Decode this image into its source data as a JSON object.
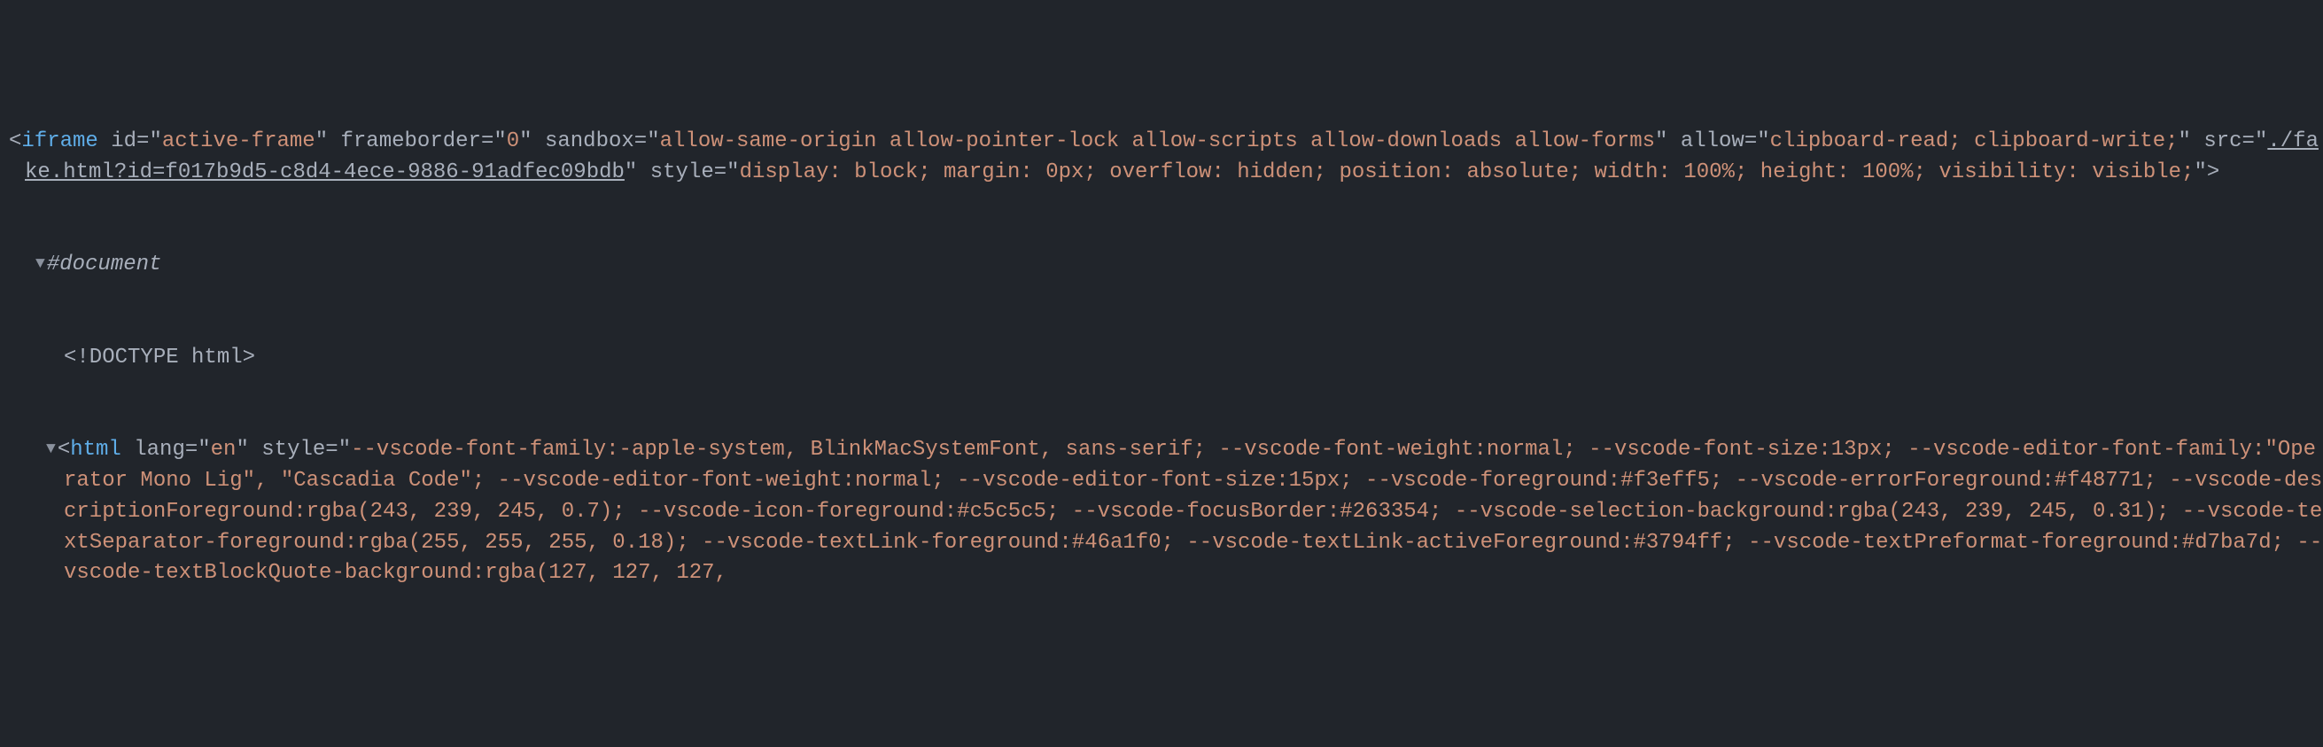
{
  "devtools": {
    "arrow_expanded": "▼",
    "tags": {
      "iframe": "iframe",
      "html": "html"
    },
    "iframe_attrs": {
      "id_name": "id",
      "id_val": "active-frame",
      "frameborder_name": "frameborder",
      "frameborder_val": "0",
      "sandbox_name": "sandbox",
      "sandbox_val": "allow-same-origin allow-pointer-lock allow-scripts allow-downloads allow-forms",
      "allow_name": "allow",
      "allow_val": "clipboard-read; clipboard-write;",
      "src_name": "src",
      "src_val": "./fake.html?id=f017b9d5-c8d4-4ece-9886-91adfec09bdb",
      "style_name": "style",
      "style_val": "display: block; margin: 0px; overflow: hidden; position: absolute; width: 100%; height: 100%; visibility: visible;"
    },
    "shadow_doc": "#document",
    "doctype": "<!DOCTYPE html>",
    "html_attrs": {
      "lang_name": "lang",
      "lang_val": "en",
      "style_name": "style",
      "style_val": "--vscode-font-family:-apple-system, BlinkMacSystemFont, sans-serif; --vscode-font-weight:normal; --vscode-font-size:13px; --vscode-editor-font-family:\"Operator Mono Lig\", \"Cascadia Code\"; --vscode-editor-font-weight:normal; --vscode-editor-font-size:15px; --vscode-foreground:#f3eff5; --vscode-errorForeground:#f48771; --vscode-descriptionForeground:rgba(243, 239, 245, 0.7); --vscode-icon-foreground:#c5c5c5; --vscode-focusBorder:#263354; --vscode-selection-background:rgba(243, 239, 245, 0.31); --vscode-textSeparator-foreground:rgba(255, 255, 255, 0.18); --vscode-textLink-foreground:#46a1f0; --vscode-textLink-activeForeground:#3794ff; --vscode-textPreformat-foreground:#d7ba7d; --vscode-textBlockQuote-background:rgba(127, 127, 127,"
    }
  }
}
